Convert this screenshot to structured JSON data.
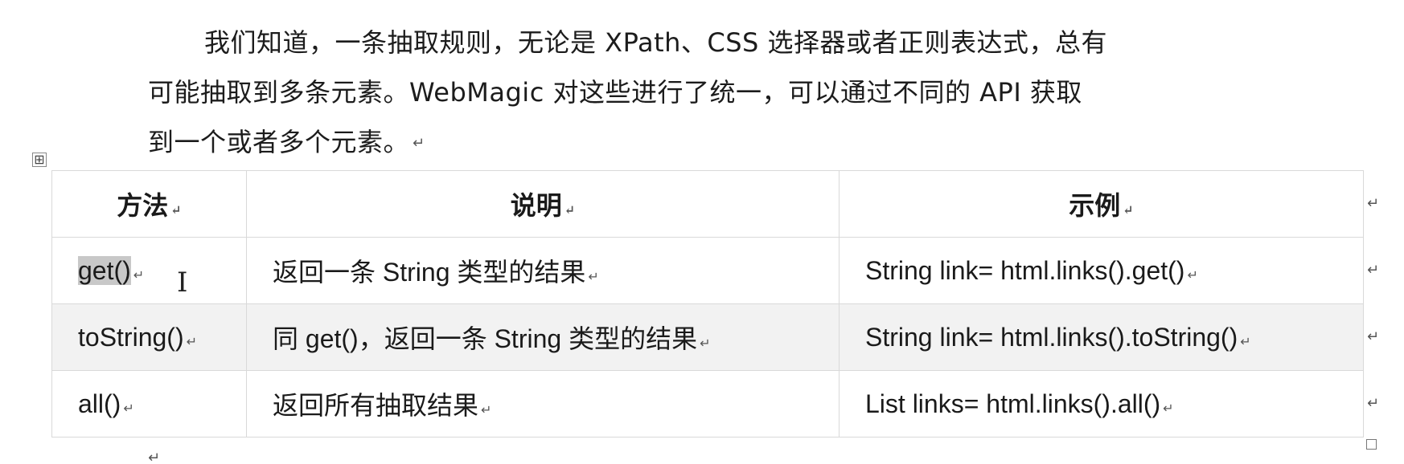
{
  "paragraph": {
    "line1": "我们知道，一条抽取规则，无论是 XPath、CSS 选择器或者正则表达式，总有",
    "line2": "可能抽取到多条元素。WebMagic 对这些进行了统一，可以通过不同的 API 获取",
    "line3": "到一个或者多个元素。"
  },
  "marks": {
    "paragraph": "↵",
    "cell": "↵",
    "move_handle": "⊞"
  },
  "table": {
    "headers": [
      "方法",
      "说明",
      "示例"
    ],
    "rows": [
      {
        "method": "get()",
        "description": "返回一条 String 类型的结果",
        "example": "String link= html.links().get()"
      },
      {
        "method": "toString()",
        "description": "同 get()，返回一条 String 类型的结果",
        "example": "String link= html.links().toString()"
      },
      {
        "method": "all()",
        "description": "返回所有抽取结果",
        "example": "List links= html.links().all()"
      }
    ]
  }
}
